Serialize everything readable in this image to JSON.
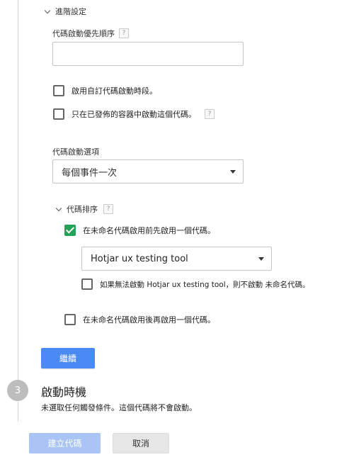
{
  "advanced": {
    "section_label": "進階設定",
    "priority_label": "代碼啟動優先順序",
    "priority_value": "",
    "help_glyph": "?",
    "enable_custom_schedule": {
      "label": "啟用自訂代碼啟動時段。",
      "checked": false
    },
    "published_only": {
      "label": "只在已發佈的容器中啟動這個代碼。",
      "checked": false
    },
    "firing_options_label": "代碼啟動選項",
    "firing_options_value": "每個事件一次",
    "sequencing": {
      "label": "代碼排序",
      "fire_before": {
        "label": "在未命名代碼啟用前先啟用一個代碼。",
        "checked": true
      },
      "setup_tag_value": "Hotjar ux testing tool",
      "dont_fire_on_fail": {
        "label": "如果無法啟動 Hotjar ux testing tool，則不啟動 未命名代碼。",
        "checked": false
      },
      "fire_after": {
        "label": "在未命名代碼啟用後再啟用一個代碼。",
        "checked": false
      }
    },
    "continue_label": "繼續"
  },
  "step3": {
    "number": "3",
    "title": "啟動時機",
    "description": "未選取任何觸發條件。這個代碼將不會啟動。"
  },
  "footer": {
    "create_label": "建立代碼",
    "cancel_label": "取消"
  },
  "colors": {
    "accent_blue": "#4a8af4",
    "checkbox_green": "#23a35a",
    "disabled_blue": "#a9c4f5"
  }
}
